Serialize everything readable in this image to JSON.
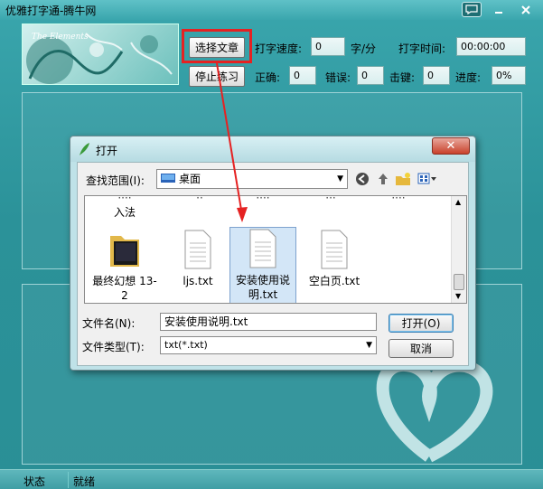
{
  "window": {
    "title": "优雅打字通-腾牛网"
  },
  "banner": {
    "logo_text": "The Elements"
  },
  "toolbar": {
    "select_article": "选择文章",
    "stop_practice": "停止练习",
    "speed_label": "打字速度:",
    "speed_value": "0",
    "speed_unit": "字/分",
    "time_label": "打字时间:",
    "time_value": "00:00:00",
    "correct_label": "正确:",
    "correct_value": "0",
    "error_label": "错误:",
    "error_value": "0",
    "keystroke_label": "击键:",
    "keystroke_value": "0",
    "progress_label": "进度:",
    "progress_value": "0%"
  },
  "status": {
    "label": "状态",
    "text": "就绪"
  },
  "dialog": {
    "title": "打开",
    "look_in_label": "查找范围(I):",
    "look_in_value": "桌面",
    "files": [
      {
        "name": "入法",
        "type": "folder-partial"
      },
      {
        "name": "最终幻想 13-2",
        "type": "folder"
      },
      {
        "name": "ljs.txt",
        "type": "txt"
      },
      {
        "name": "安装使用说明.txt",
        "type": "txt"
      },
      {
        "name": "空白页.txt",
        "type": "txt"
      }
    ],
    "file_name_label": "文件名(N):",
    "file_name_value": "安装使用说明.txt",
    "file_type_label": "文件类型(T):",
    "file_type_value": "txt(*.txt)",
    "open_button": "打开(O)",
    "cancel_button": "取消"
  },
  "colors": {
    "accent_red": "#e52222",
    "teal": "#2f9aa0"
  }
}
